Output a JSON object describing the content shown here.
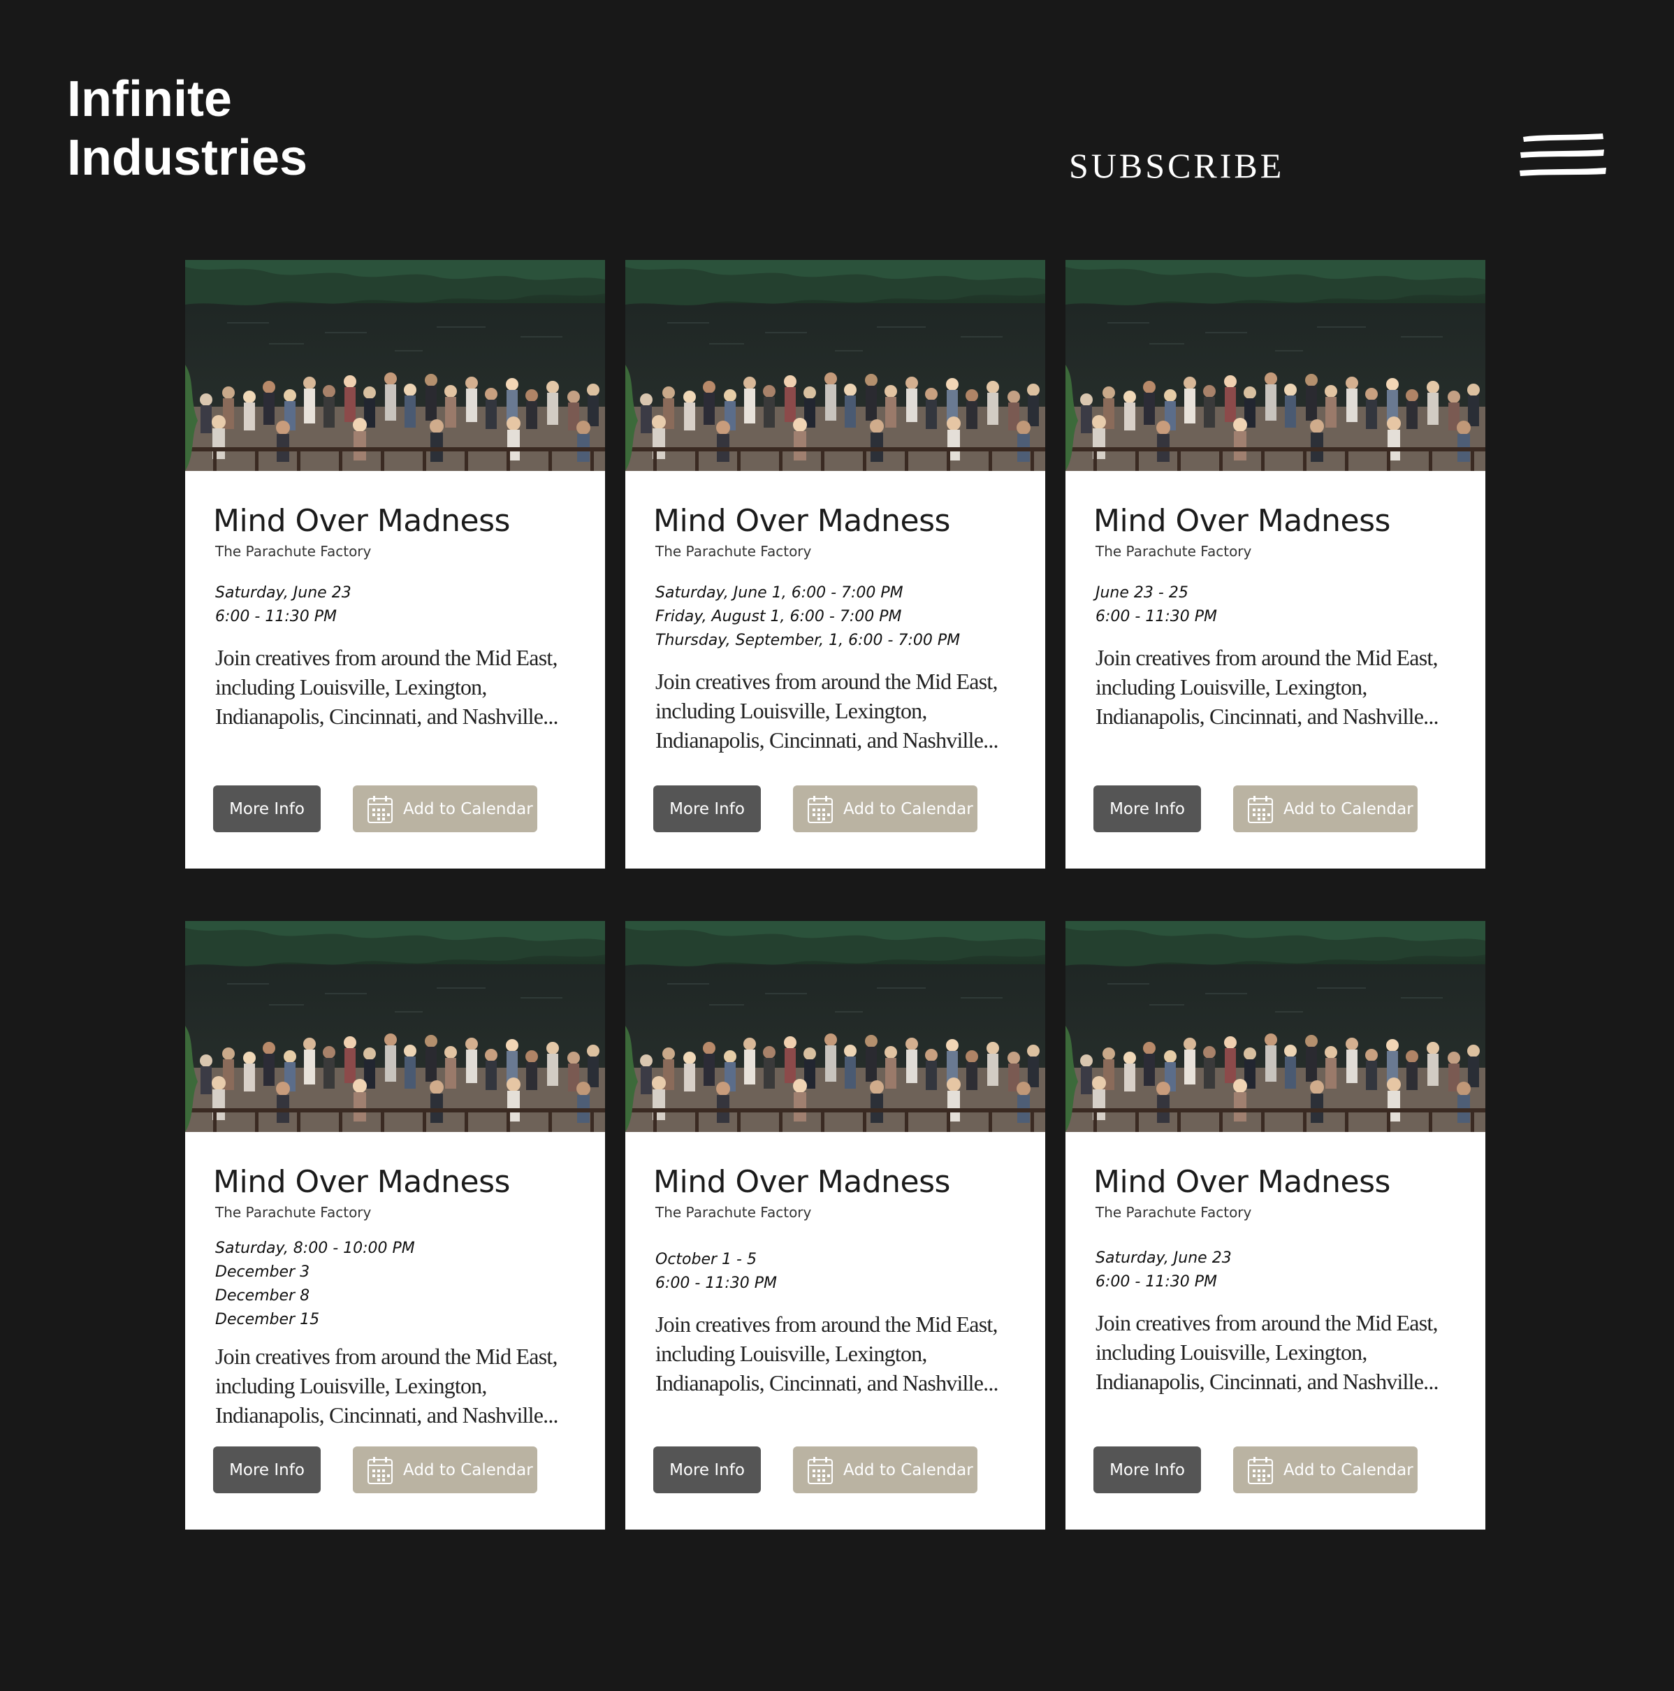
{
  "brand": {
    "line1": "Infinite",
    "line2": "Industries"
  },
  "header": {
    "subscribe_label": "SUBSCRIBE",
    "menu_icon": "hamburger-menu-icon"
  },
  "colors": {
    "background": "#181818",
    "card_background": "#ffffff",
    "more_info_button": "#555555",
    "calendar_button": "#bab3a2"
  },
  "events": [
    {
      "title": "Mind Over Madness",
      "venue": "The Parachute Factory",
      "dates": [
        "Saturday, June 23",
        "6:00 - 11:30 PM"
      ],
      "description": "Join creatives from around the Mid East, including Louisville, Lexington, Indianapolis, Cincinnati, and Nashville...",
      "more_info_label": "More Info",
      "calendar_label": "Add to Calendar"
    },
    {
      "title": "Mind Over Madness",
      "venue": "The Parachute Factory",
      "dates": [
        "Saturday, June 1, 6:00 - 7:00 PM",
        "Friday, August 1, 6:00 - 7:00 PM",
        "Thursday, September, 1, 6:00 - 7:00 PM"
      ],
      "description": "Join creatives from around the Mid East, including Louisville, Lexington, Indianapolis, Cincinnati, and Nashville...",
      "more_info_label": "More Info",
      "calendar_label": "Add to Calendar"
    },
    {
      "title": "Mind Over Madness",
      "venue": "The Parachute Factory",
      "dates": [
        "June 23 - 25",
        "6:00 - 11:30 PM"
      ],
      "description": "Join creatives from around the Mid East, including Louisville, Lexington, Indianapolis, Cincinnati, and Nashville...",
      "more_info_label": "More Info",
      "calendar_label": "Add to Calendar"
    },
    {
      "title": "Mind Over Madness",
      "venue": "The Parachute Factory",
      "dates": [
        "Saturday, 8:00 - 10:00 PM",
        "December 3",
        "December 8",
        "December 15"
      ],
      "description": "Join creatives from around the Mid East, including Louisville, Lexington, Indianapolis, Cincinnati, and Nashville...",
      "more_info_label": "More Info",
      "calendar_label": "Add to Calendar"
    },
    {
      "title": "Mind Over Madness",
      "venue": "The Parachute Factory",
      "dates": [
        "October 1 - 5",
        "6:00 - 11:30 PM"
      ],
      "description": "Join creatives from around the Mid East, including Louisville, Lexington, Indianapolis, Cincinnati, and Nashville...",
      "more_info_label": "More Info",
      "calendar_label": "Add to Calendar"
    },
    {
      "title": "Mind Over Madness",
      "venue": "The Parachute Factory",
      "dates": [
        "Saturday, June 23",
        "6:00 - 11:30 PM"
      ],
      "description": "Join creatives from around the Mid East, including Louisville, Lexington, Indianapolis, Cincinnati, and Nashville...",
      "more_info_label": "More Info",
      "calendar_label": "Add to Calendar"
    }
  ]
}
